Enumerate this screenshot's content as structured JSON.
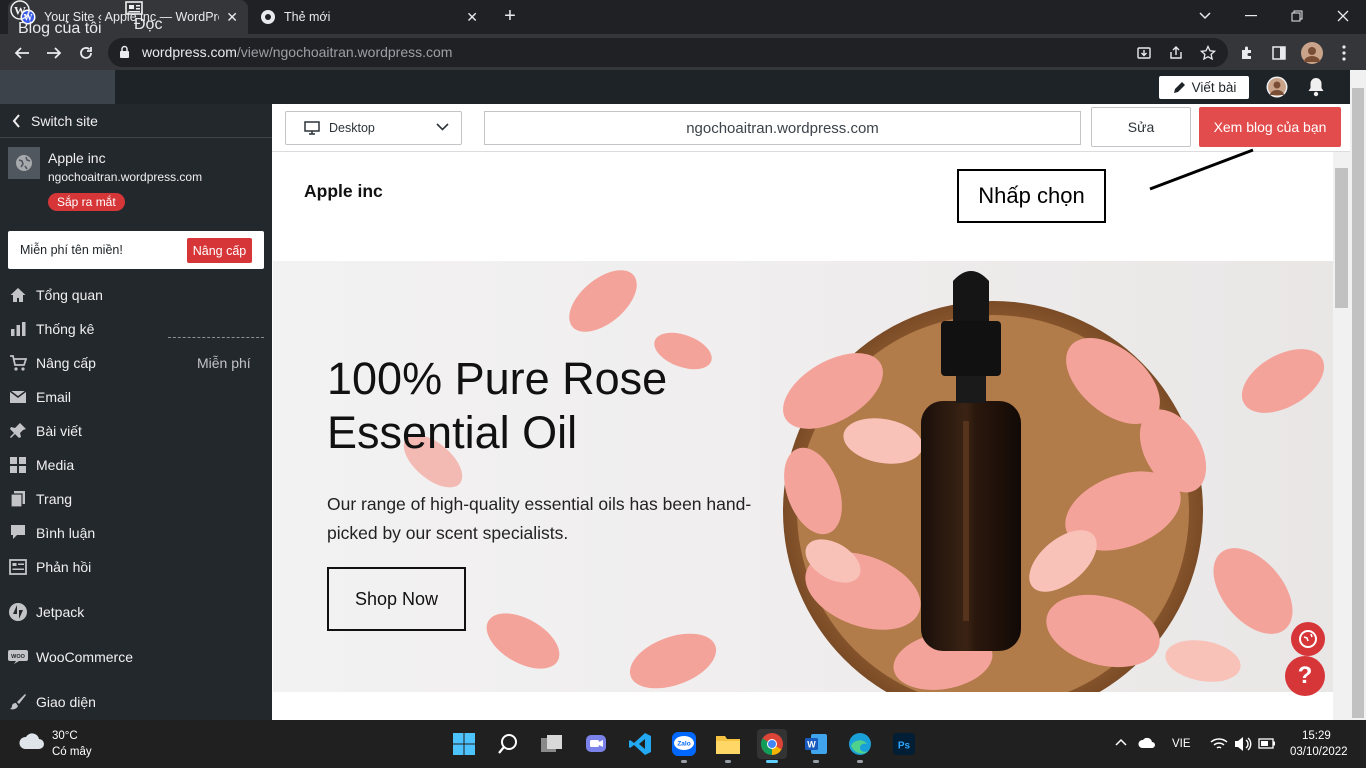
{
  "browser": {
    "tabs": [
      {
        "title": "Your Site ‹ Apple inc — WordPress",
        "active": true
      },
      {
        "title": "Thẻ mới",
        "active": false
      }
    ],
    "url_host": "wordpress.com",
    "url_path": "/view/ngochoaitran.wordpress.com"
  },
  "adminbar": {
    "my_blog": "Blog của tôi",
    "reader": "Đọc",
    "write": "Viết bài"
  },
  "sidebar": {
    "switch_site": "Switch site",
    "site_name": "Apple inc",
    "site_url": "ngochoaitran.wordpress.com",
    "badge": "Sắp ra mắt",
    "domain_promo": "Miễn phí tên miền!",
    "domain_upgrade": "Nâng cấp",
    "items": [
      {
        "label": "Tổng quan",
        "icon": "home-icon"
      },
      {
        "label": "Thống kê",
        "icon": "stats-icon"
      },
      {
        "label": "Nâng cấp",
        "icon": "cart-icon",
        "extra": "Miễn phí"
      },
      {
        "label": "Email",
        "icon": "mail-icon"
      },
      {
        "label": "Bài viết",
        "icon": "pin-icon"
      },
      {
        "label": "Media",
        "icon": "media-icon"
      },
      {
        "label": "Trang",
        "icon": "page-icon"
      },
      {
        "label": "Bình luận",
        "icon": "comment-icon"
      },
      {
        "label": "Phản hồi",
        "icon": "feedback-icon"
      },
      {
        "label": "Jetpack",
        "icon": "jetpack-icon"
      },
      {
        "label": "WooCommerce",
        "icon": "woo-icon"
      },
      {
        "label": "Giao diện",
        "icon": "brush-icon"
      }
    ]
  },
  "preview_bar": {
    "device": "Desktop",
    "url": "ngochoaitran.wordpress.com",
    "edit": "Sửa",
    "view_blog": "Xem blog của bạn"
  },
  "site": {
    "title": "Apple inc",
    "hero_title": "100% Pure Rose Essential Oil",
    "hero_body": "Our range of high-quality essential oils has been hand-picked by our scent specialists.",
    "cta": "Shop Now"
  },
  "annotation": {
    "callout": "Nhấp chọn"
  },
  "taskbar": {
    "temperature": "30°C",
    "weather": "Có mây",
    "language": "VIE",
    "time": "15:29",
    "date": "03/10/2022"
  },
  "colors": {
    "wp_red": "#e34c4c",
    "sidebar_bg": "#23282d",
    "adminbar_bg": "#1d2327"
  }
}
